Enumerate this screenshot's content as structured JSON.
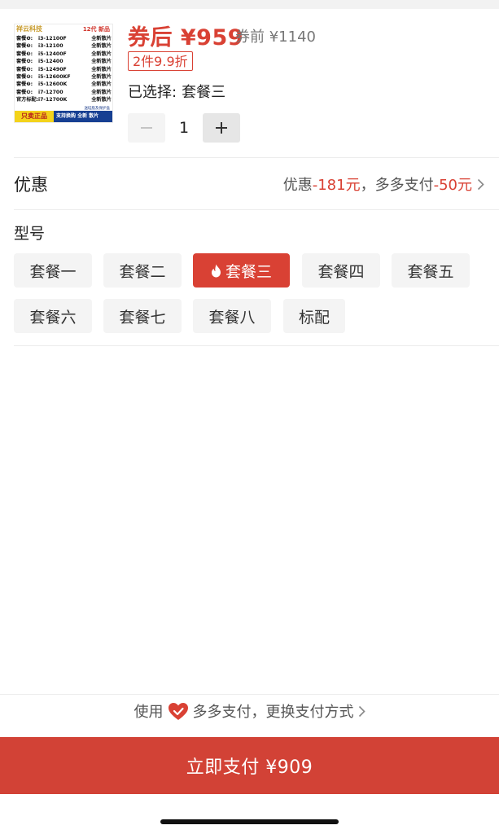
{
  "product": {
    "thumbnail": {
      "brand": "祥云科技",
      "generation": "12代 新品",
      "rows": [
        {
          "pkg": "套餐❶:",
          "cpu": "i3-12100F",
          "note": "全新散片"
        },
        {
          "pkg": "套餐❷:",
          "cpu": "i3-12100",
          "note": "全新散片"
        },
        {
          "pkg": "套餐❸:",
          "cpu": "i5-12400F",
          "note": "全新散片"
        },
        {
          "pkg": "套餐❹:",
          "cpu": "i5-12400",
          "note": "全新散片"
        },
        {
          "pkg": "套餐❺:",
          "cpu": "i5-12490F",
          "note": "全新散片"
        },
        {
          "pkg": "套餐❻:",
          "cpu": "i5-12600KF",
          "note": "全新散片"
        },
        {
          "pkg": "套餐❼:",
          "cpu": "i5-12600K",
          "note": "全新散片"
        },
        {
          "pkg": "套餐❽:",
          "cpu": "i7-12700",
          "note": "全新散片"
        },
        {
          "pkg": "官方标配:",
          "cpu": "i7-12700K",
          "note": "全新散片"
        }
      ],
      "note": "送硅脂及保护盒",
      "badge_left": "只卖正品",
      "badge_right": "支持换购 全新 散片"
    },
    "price_after": "券后 ¥959",
    "price_before": "券前 ¥1140",
    "promo_tag": "2件9.9折",
    "selected_label": "已选择:",
    "selected_value": "套餐三",
    "quantity": "1"
  },
  "discount": {
    "title": "优惠",
    "detail_prefix": "优惠",
    "detail_amount1": "-181元",
    "detail_middle": "，多多支付",
    "detail_amount2": "-50元"
  },
  "model": {
    "title": "型号",
    "options": [
      "套餐一",
      "套餐二",
      "套餐三",
      "套餐四",
      "套餐五",
      "套餐六",
      "套餐七",
      "套餐八",
      "标配"
    ],
    "selected_index": 2
  },
  "payment": {
    "method_prefix": "使用",
    "method_suffix": "多多支付，更换支付方式",
    "pay_button": "立即支付 ¥909"
  },
  "colors": {
    "accent": "#d94134",
    "pay_button": "#d24236",
    "option_bg": "#f4f4f4"
  }
}
